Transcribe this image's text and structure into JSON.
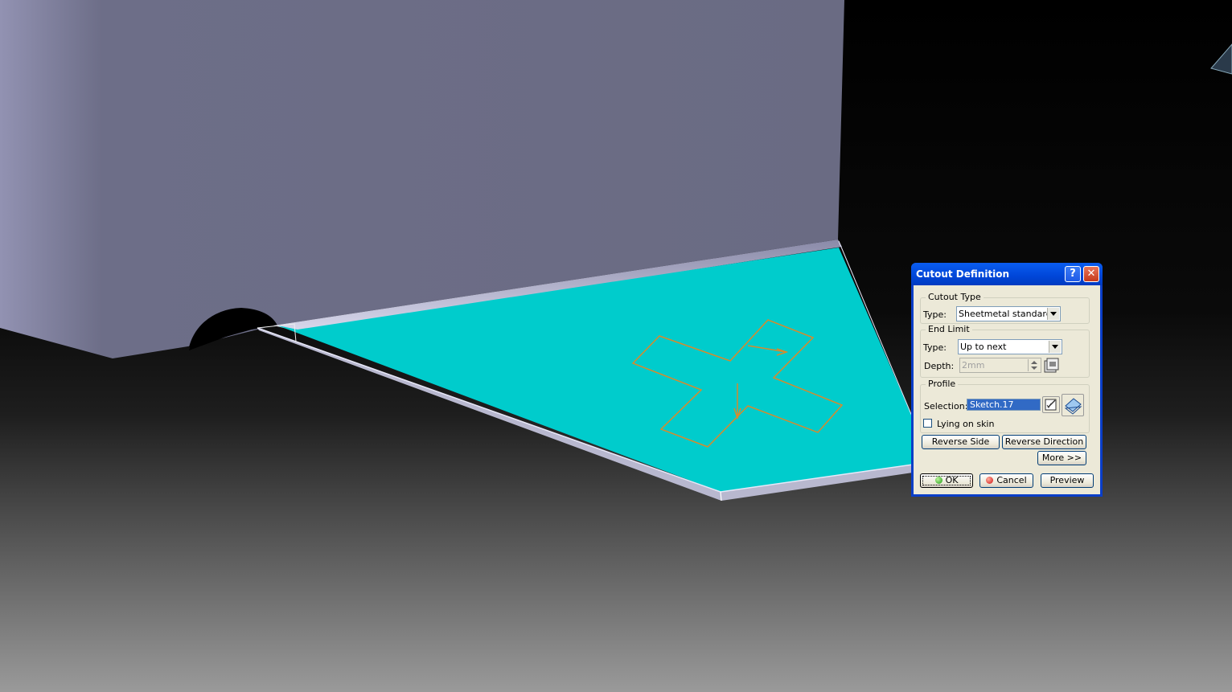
{
  "dialog": {
    "title": "Cutout Definition",
    "help_glyph": "?",
    "close_glyph": "✕",
    "cutout_type": {
      "group_label": "Cutout Type",
      "type_label": "Type:",
      "type_value": "Sheetmetal standard"
    },
    "end_limit": {
      "group_label": "End Limit",
      "type_label": "Type:",
      "type_value": "Up to next",
      "depth_label": "Depth:",
      "depth_value": "2mm"
    },
    "profile": {
      "group_label": "Profile",
      "selection_label": "Selection:",
      "selection_value": "Sketch.17",
      "lying_on_skin_label": "Lying on skin",
      "lying_on_skin_checked": false
    },
    "buttons": {
      "reverse_side": "Reverse Side",
      "reverse_direction": "Reverse Direction",
      "more": "More >>",
      "ok": "OK",
      "cancel": "Cancel",
      "preview": "Preview"
    }
  },
  "colors": {
    "viewport_background_top": "#000000",
    "viewport_background_bottom": "#9a9a9a",
    "wall_face": "#6b6c85",
    "plate_face": "#00cccc",
    "sketch_profile": "#d98a2b",
    "dialog_frame": "#0a3ec8",
    "dialog_body": "#ece9d8"
  },
  "icons": [
    "question-icon",
    "close-icon",
    "depth-settings-icon",
    "sketcher-icon",
    "sketch-plane-icon"
  ]
}
